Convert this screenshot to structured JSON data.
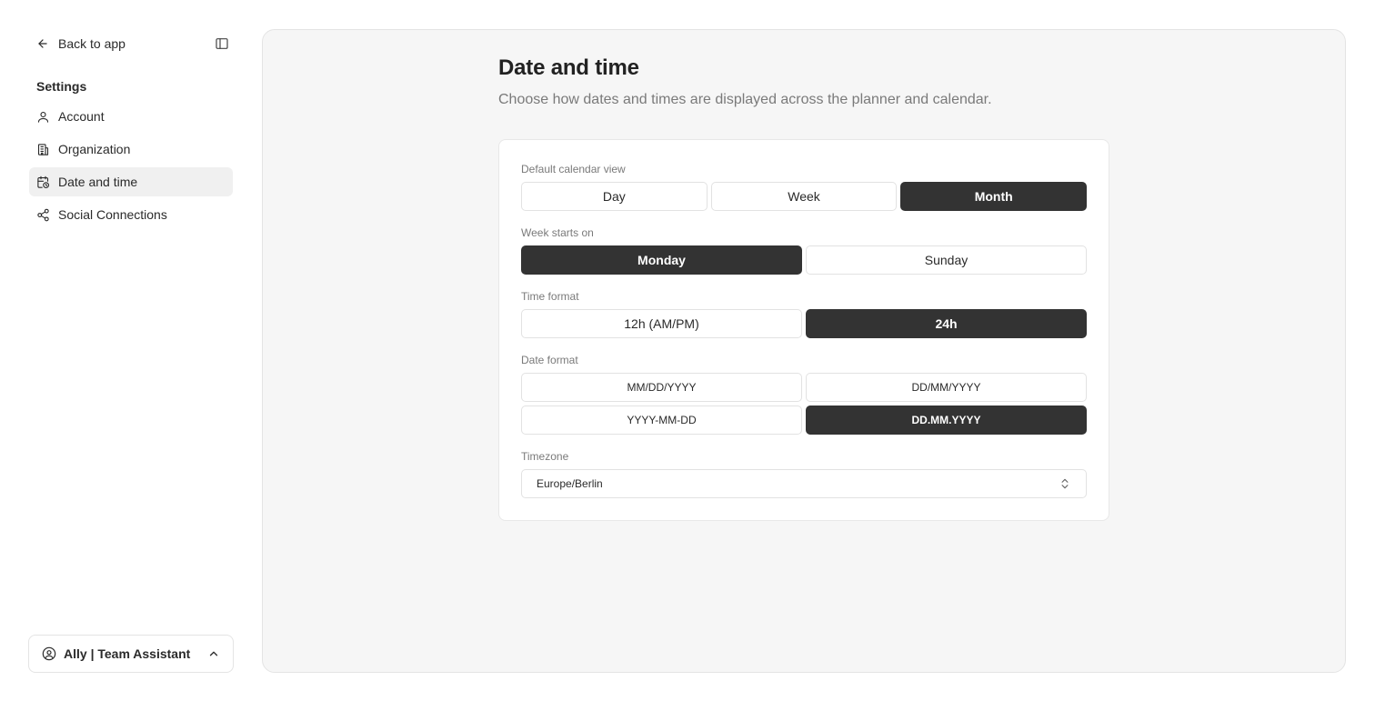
{
  "sidebar": {
    "back_label": "Back to app",
    "section_title": "Settings",
    "items": [
      {
        "label": "Account",
        "icon": "user-icon"
      },
      {
        "label": "Organization",
        "icon": "building-icon"
      },
      {
        "label": "Date and time",
        "icon": "calendar-clock-icon",
        "active": true
      },
      {
        "label": "Social Connections",
        "icon": "share-icon"
      }
    ],
    "user_label": "Ally | Team Assistant"
  },
  "main": {
    "title": "Date and time",
    "subtitle": "Choose how dates and times are displayed across the planner and calendar."
  },
  "settings": {
    "calendar_view": {
      "label": "Default calendar view",
      "options": [
        "Day",
        "Week",
        "Month"
      ],
      "selected": "Month"
    },
    "week_start": {
      "label": "Week starts on",
      "options": [
        "Monday",
        "Sunday"
      ],
      "selected": "Monday"
    },
    "time_format": {
      "label": "Time format",
      "options": [
        "12h (AM/PM)",
        "24h"
      ],
      "selected": "24h"
    },
    "date_format": {
      "label": "Date format",
      "options": [
        "MM/DD/YYYY",
        "DD/MM/YYYY",
        "YYYY-MM-DD",
        "DD.MM.YYYY"
      ],
      "selected": "DD.MM.YYYY"
    },
    "timezone": {
      "label": "Timezone",
      "value": "Europe/Berlin"
    }
  },
  "colors": {
    "selected_bg": "#333333",
    "panel_bg": "#f6f6f6",
    "active_nav_bg": "#f0f0f0"
  }
}
